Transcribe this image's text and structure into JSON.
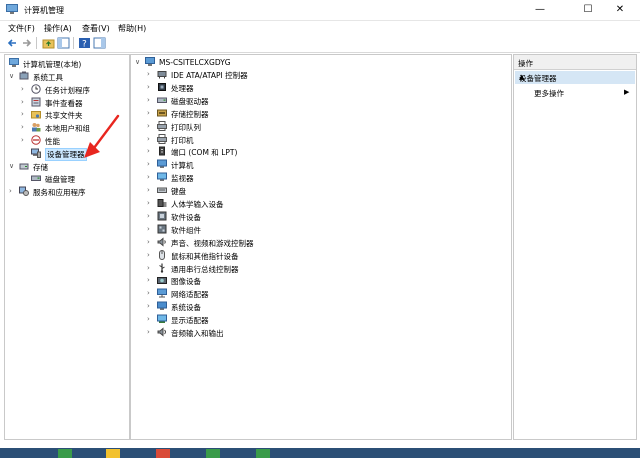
{
  "window": {
    "title": "计算机管理"
  },
  "menu": [
    "文件(F)",
    "操作(A)",
    "查看(V)",
    "帮助(H)"
  ],
  "tree": {
    "root": "计算机管理(本地)",
    "items": [
      {
        "label": "系统工具",
        "level": 1,
        "expander": "∨",
        "icon": "tools-icon"
      },
      {
        "label": "任务计划程序",
        "level": 2,
        "expander": "›",
        "icon": "clock-icon"
      },
      {
        "label": "事件查看器",
        "level": 2,
        "expander": "›",
        "icon": "event-viewer-icon"
      },
      {
        "label": "共享文件夹",
        "level": 2,
        "expander": "›",
        "icon": "shared-folder-icon"
      },
      {
        "label": "本地用户和组",
        "level": 2,
        "expander": "›",
        "icon": "users-icon"
      },
      {
        "label": "性能",
        "level": 2,
        "expander": "›",
        "icon": "performance-icon"
      },
      {
        "label": "设备管理器",
        "level": 2,
        "expander": "",
        "icon": "device-manager-icon",
        "selected": true
      },
      {
        "label": "存储",
        "level": 1,
        "expander": "∨",
        "icon": "storage-icon"
      },
      {
        "label": "磁盘管理",
        "level": 2,
        "expander": "",
        "icon": "disk-icon"
      },
      {
        "label": "服务和应用程序",
        "level": 1,
        "expander": "›",
        "icon": "services-icon"
      }
    ]
  },
  "devices": {
    "computer_name": "MS-CSITELCXGDYG",
    "items": [
      {
        "label": "IDE ATA/ATAPI 控制器",
        "icon": "ide-controller-icon"
      },
      {
        "label": "处理器",
        "icon": "processor-icon"
      },
      {
        "label": "磁盘驱动器",
        "icon": "disk-drive-icon"
      },
      {
        "label": "存储控制器",
        "icon": "storage-controller-icon"
      },
      {
        "label": "打印队列",
        "icon": "print-queue-icon"
      },
      {
        "label": "打印机",
        "icon": "printer-icon"
      },
      {
        "label": "端口 (COM 和 LPT)",
        "icon": "port-icon"
      },
      {
        "label": "计算机",
        "icon": "computer-icon"
      },
      {
        "label": "监视器",
        "icon": "monitor-icon"
      },
      {
        "label": "键盘",
        "icon": "keyboard-icon"
      },
      {
        "label": "人体学输入设备",
        "icon": "hid-icon"
      },
      {
        "label": "软件设备",
        "icon": "software-device-icon"
      },
      {
        "label": "软件组件",
        "icon": "software-component-icon"
      },
      {
        "label": "声音、视频和游戏控制器",
        "icon": "sound-icon"
      },
      {
        "label": "鼠标和其他指针设备",
        "icon": "mouse-icon"
      },
      {
        "label": "通用串行总线控制器",
        "icon": "usb-icon"
      },
      {
        "label": "图像设备",
        "icon": "imaging-icon"
      },
      {
        "label": "网络适配器",
        "icon": "network-adapter-icon"
      },
      {
        "label": "系统设备",
        "icon": "system-device-icon"
      },
      {
        "label": "显示适配器",
        "icon": "display-adapter-icon"
      },
      {
        "label": "音频输入和输出",
        "icon": "audio-io-icon"
      }
    ]
  },
  "actions": {
    "header": "操作",
    "section": "设备管理器",
    "more": "更多操作"
  },
  "colors": {
    "selection": "#cce8ff",
    "action_section": "#d5e6f5",
    "arrow": "#e8261f",
    "taskbar": "#2b4f76"
  }
}
